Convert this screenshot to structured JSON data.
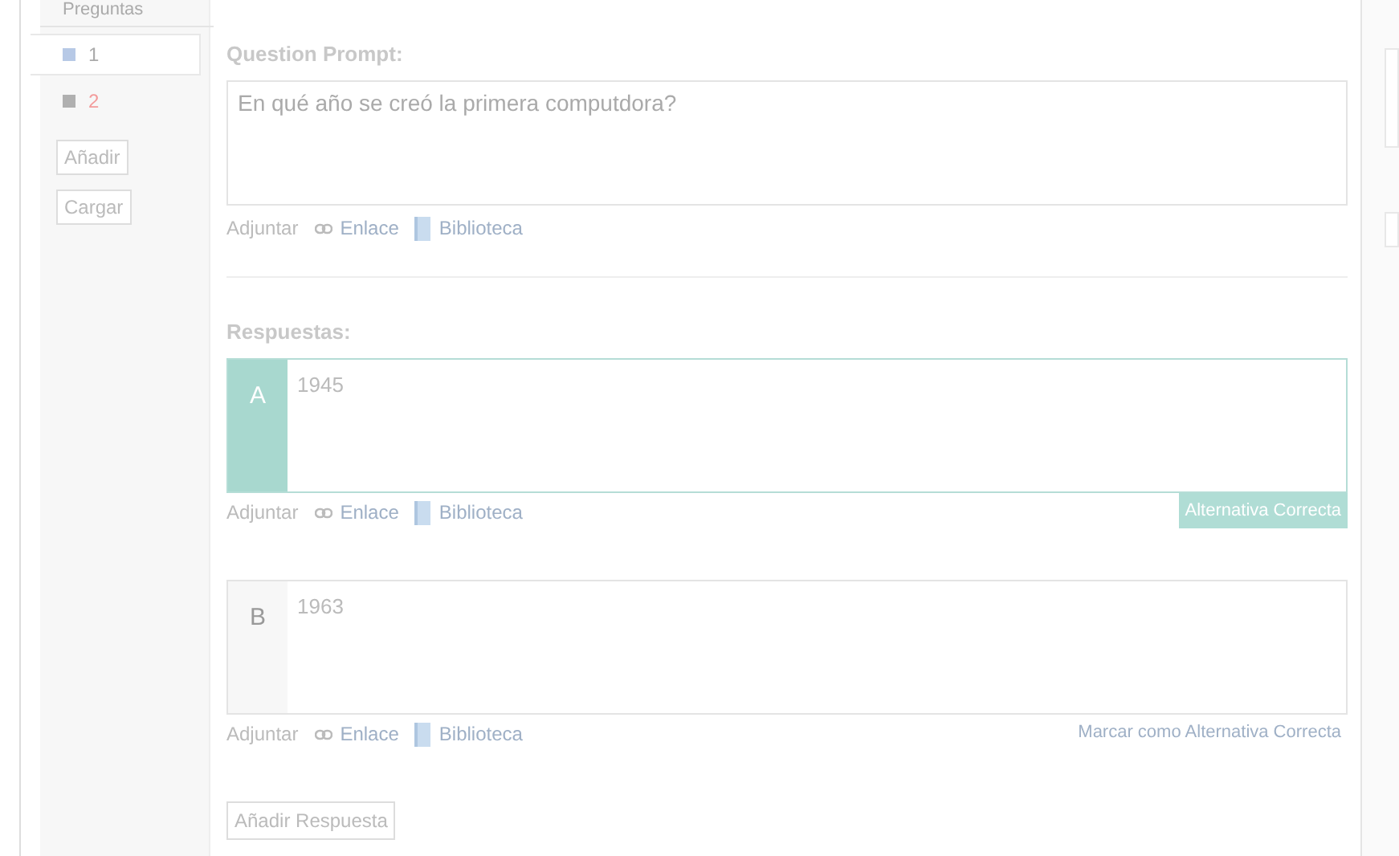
{
  "sidebar": {
    "heading": "Preguntas",
    "items": [
      {
        "label": "1",
        "selected": true,
        "color": "#b7c9e6"
      },
      {
        "label": "2",
        "selected": false,
        "color": "#b0b0b0"
      }
    ],
    "buttons": [
      "Añadir",
      "Cargar"
    ]
  },
  "prompt": {
    "label": "Question Prompt:",
    "value": "En qué año se creó la primera computdora?",
    "attach": {
      "label": "Adjuntar",
      "link": "Enlace",
      "library": "Biblioteca"
    }
  },
  "answers_label": "Respuestas:",
  "answers": [
    {
      "letter": "A",
      "value": "1945",
      "correct": true,
      "correct_label": "Alternativa Correcta",
      "attach": {
        "label": "Adjuntar",
        "link": "Enlace",
        "library": "Biblioteca"
      }
    },
    {
      "letter": "B",
      "value": "1963",
      "correct": false,
      "correct_label": "Marcar como Alternativa Correcta",
      "attach": {
        "label": "Adjuntar",
        "link": "Enlace",
        "library": "Biblioteca"
      }
    }
  ],
  "add_answer": "Añadir Respuesta"
}
